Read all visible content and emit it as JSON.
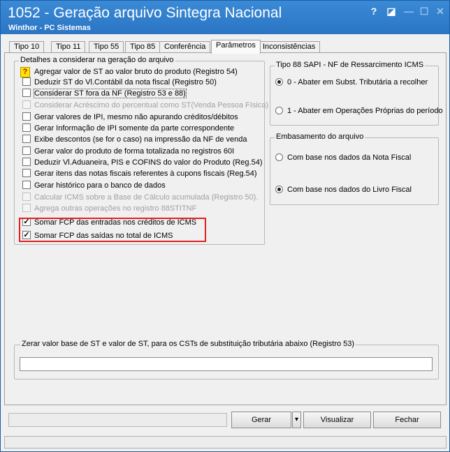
{
  "window": {
    "title": "1052 - Geração arquivo Sintegra Nacional",
    "subtitle": "Winthor - PC Sistemas",
    "help_symbol": "?",
    "restore_symbol": "◪",
    "minimize_symbol": "—",
    "maximize_symbol": "☐",
    "close_symbol": "✕"
  },
  "tabs": [
    {
      "label": "Tipo 10"
    },
    {
      "label": "Tipo 11"
    },
    {
      "label": "Tipo 55"
    },
    {
      "label": "Tipo 85"
    },
    {
      "label": "Conferência"
    },
    {
      "label": "Parâmetros"
    },
    {
      "label": "Inconsistências"
    }
  ],
  "detalhes": {
    "legend": "Detalhes a considerar na geração do arquivo",
    "items": [
      {
        "label": "Agregar valor de ST ao valor bruto do produto (Registro 54)",
        "checked": false,
        "disabled": false,
        "icon": "question-icon"
      },
      {
        "label": "Deduzir ST do Vl.Contábil da nota fiscal (Registro 50)",
        "checked": false,
        "disabled": false
      },
      {
        "label": "Considerar ST fora da NF (Registro 53 e 88)",
        "checked": false,
        "disabled": false
      },
      {
        "label": "Considerar Acréscimo do percentual como ST(Venda Pessoa Física)",
        "checked": false,
        "disabled": true
      },
      {
        "label": "Gerar valores de IPI, mesmo não apurando créditos/débitos",
        "checked": false,
        "disabled": false
      },
      {
        "label": "Gerar Informação de IPI somente da parte correspondente",
        "checked": false,
        "disabled": false
      },
      {
        "label": "Exibe descontos (se for o caso) na impressão da NF de venda",
        "checked": false,
        "disabled": false
      },
      {
        "label": "Gerar valor do produto de forma totalizada no registros 60I",
        "checked": false,
        "disabled": false
      },
      {
        "label": "Deduzir Vl.Aduaneira, PIS e COFINS do valor do Produto (Reg.54)",
        "checked": false,
        "disabled": false
      },
      {
        "label": "Gerar itens das notas fiscais referentes à cupons fiscais (Reg.54)",
        "checked": false,
        "disabled": false
      },
      {
        "label": "Gerar histórico para o banco de dados",
        "checked": false,
        "disabled": false
      },
      {
        "label": "Calcular ICMS sobre a Base de Cálculo acumulada (Registro 50).",
        "checked": false,
        "disabled": true
      },
      {
        "label": "Agrega outras operações no registro 88STITNF",
        "checked": false,
        "disabled": true
      },
      {
        "label": "Somar FCP das entradas nos créditos de ICMS",
        "checked": true,
        "disabled": false
      },
      {
        "label": "Somar FCP das saídas no total de ICMS",
        "checked": true,
        "disabled": false
      }
    ]
  },
  "tipo88": {
    "legend": "Tipo 88  SAPI - NF de Ressarcimento ICMS",
    "options": [
      {
        "label": "0 - Abater em Subst. Tributária a recolher",
        "selected": true
      },
      {
        "label": "1 - Abater em Operações Próprias do período",
        "selected": false
      }
    ]
  },
  "embasamento": {
    "legend": "Embasamento do arquivo",
    "options": [
      {
        "label": "Com base nos dados da Nota Fiscal",
        "selected": false
      },
      {
        "label": "Com base nos dados do Livro Fiscal",
        "selected": true
      }
    ]
  },
  "zerar": {
    "legend": "Zerar valor base de ST e valor de ST, para os CSTs de substituição tributária abaixo (Registro 53)",
    "value": ""
  },
  "footer": {
    "status_value": "",
    "gerar_label": "Gerar",
    "gerar_dropdown_symbol": "▾",
    "visualizar_label": "Visualizar",
    "fechar_label": "Fechar"
  },
  "colors": {
    "titlebar": "#2a75c4",
    "highlight_box": "#e02020"
  }
}
